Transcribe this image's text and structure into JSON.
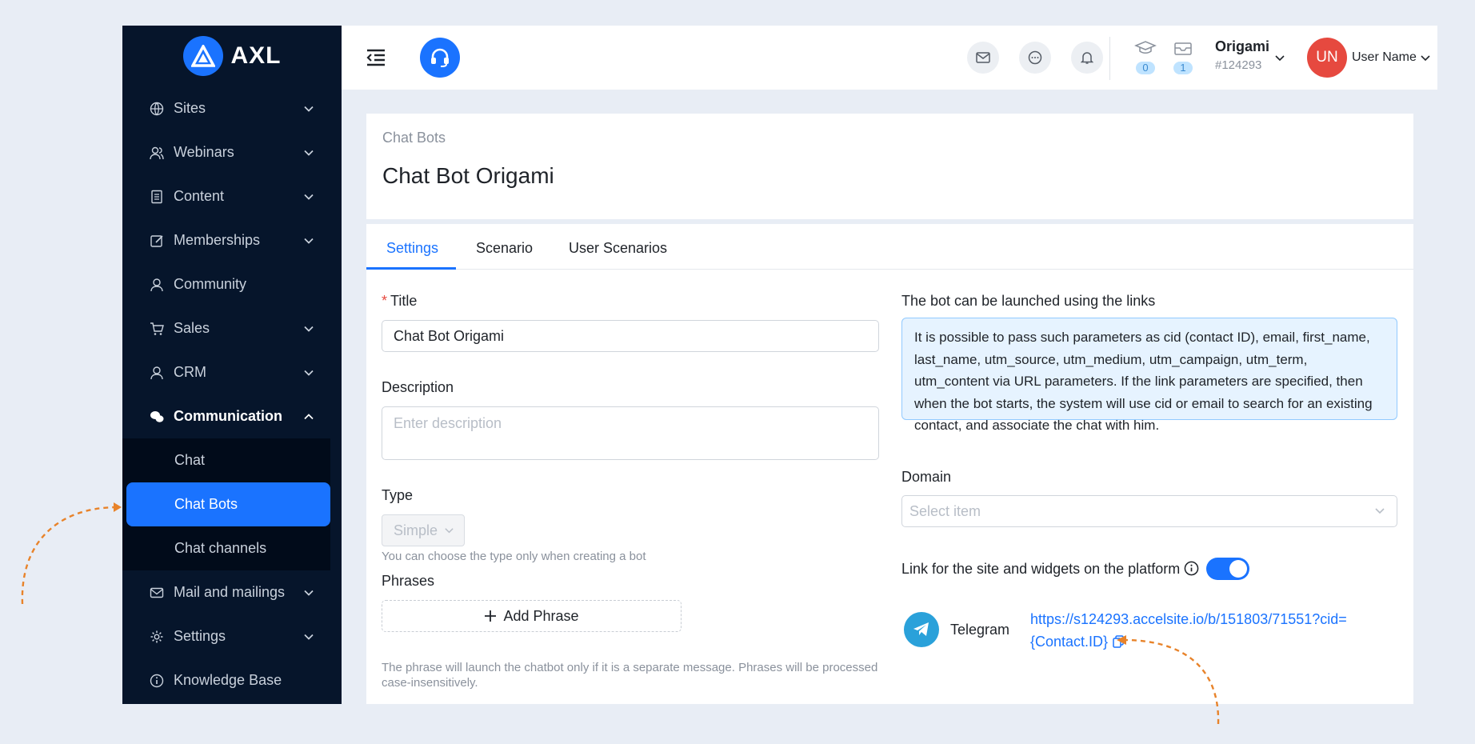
{
  "app": {
    "logo_text": "AXL"
  },
  "sidebar": {
    "items": [
      {
        "label": "Sites",
        "icon": "globe-icon"
      },
      {
        "label": "Webinars",
        "icon": "users-icon"
      },
      {
        "label": "Content",
        "icon": "document-icon"
      },
      {
        "label": "Memberships",
        "icon": "edit-icon"
      },
      {
        "label": "Community",
        "icon": "user-icon"
      },
      {
        "label": "Sales",
        "icon": "cart-icon"
      },
      {
        "label": "CRM",
        "icon": "user-icon"
      },
      {
        "label": "Communication",
        "icon": "chat-bubbles-icon"
      }
    ],
    "submenu": [
      {
        "label": "Chat"
      },
      {
        "label": "Chat Bots"
      },
      {
        "label": "Chat channels"
      }
    ],
    "items_after": [
      {
        "label": "Mail and mailings",
        "icon": "mail-icon"
      },
      {
        "label": "Settings",
        "icon": "gear-icon"
      },
      {
        "label": "Knowledge Base",
        "icon": "info-icon"
      }
    ]
  },
  "header": {
    "counters": [
      {
        "icon": "graduation-cap-icon",
        "value": "0"
      },
      {
        "icon": "inbox-icon",
        "value": "1"
      }
    ],
    "account_name": "Origami",
    "account_id": "#124293",
    "avatar_initials": "UN",
    "user_name": "User Name"
  },
  "page": {
    "breadcrumb": "Chat Bots",
    "title": "Chat Bot Origami"
  },
  "tabs": [
    "Settings",
    "Scenario",
    "User Scenarios"
  ],
  "form": {
    "title_label": "Title",
    "title_value": "Chat Bot Origami",
    "description_label": "Description",
    "description_placeholder": "Enter description",
    "type_label": "Type",
    "type_value": "Simple",
    "type_hint": "You can choose the type only when creating a bot",
    "phrases_label": "Phrases",
    "add_phrase_label": "Add Phrase",
    "phrases_hint": "The phrase will launch the chatbot only if it is a separate message. Phrases will be processed case-insensitively."
  },
  "links": {
    "heading": "The bot can be launched using the links",
    "info_text": "It is possible to pass such parameters as cid (contact ID), email, first_name, last_name, utm_source, utm_medium, utm_campaign, utm_term, utm_content via URL parameters. If the link parameters are specified, then when the bot starts, the system will use cid or email to search for an existing contact, and associate the chat with him.",
    "domain_label": "Domain",
    "domain_placeholder": "Select item",
    "platform_link_label": "Link for the site and widgets on the platform",
    "platform_link_enabled": true,
    "telegram_label": "Telegram",
    "telegram_url_line1": "https://s124293.accelsite.io/b/151803/71551?cid=",
    "telegram_url_line2": "{Contact.ID}"
  },
  "colors": {
    "accent": "#1a73ff",
    "sidebar_bg": "#06152b",
    "avatar": "#e6493f",
    "annotation": "#e8832a",
    "telegram": "#2aa1da"
  }
}
